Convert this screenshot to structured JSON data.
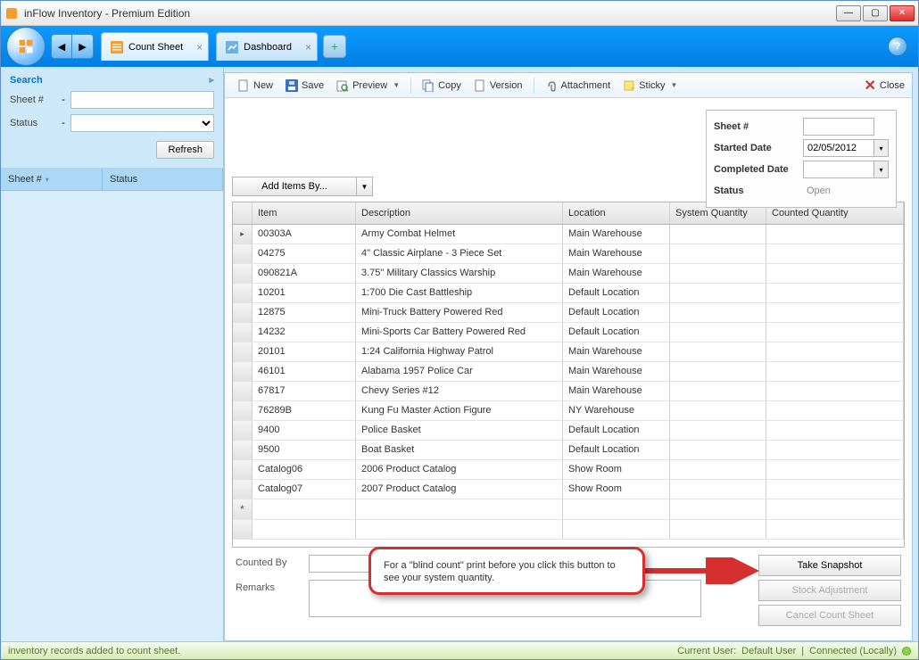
{
  "window": {
    "title": "inFlow Inventory - Premium Edition"
  },
  "tabs": [
    {
      "label": "Count Sheet",
      "active": true
    },
    {
      "label": "Dashboard",
      "active": false
    }
  ],
  "sidebar": {
    "search_title": "Search",
    "sheet_label": "Sheet #",
    "status_label": "Status",
    "refresh": "Refresh",
    "grid_head": {
      "sheet": "Sheet #",
      "status": "Status"
    }
  },
  "toolbar": {
    "new": "New",
    "save": "Save",
    "preview": "Preview",
    "copy": "Copy",
    "version": "Version",
    "attachment": "Attachment",
    "sticky": "Sticky",
    "close": "Close"
  },
  "info": {
    "sheet_label": "Sheet #",
    "sheet_value": "",
    "started_label": "Started Date",
    "started_value": "02/05/2012",
    "completed_label": "Completed Date",
    "completed_value": "",
    "status_label": "Status",
    "status_value": "Open"
  },
  "add_items_by": "Add Items By...",
  "grid": {
    "headers": {
      "item": "Item",
      "desc": "Description",
      "loc": "Location",
      "sys": "System Quantity",
      "cnt": "Counted Quantity"
    },
    "rows": [
      {
        "item": "00303A",
        "desc": "Army Combat Helmet",
        "loc": "Main Warehouse",
        "sys": "",
        "cnt": ""
      },
      {
        "item": "04275",
        "desc": "4\" Classic Airplane - 3 Piece Set",
        "loc": "Main Warehouse",
        "sys": "",
        "cnt": ""
      },
      {
        "item": "090821A",
        "desc": "3.75\" Military Classics Warship",
        "loc": "Main Warehouse",
        "sys": "",
        "cnt": ""
      },
      {
        "item": "10201",
        "desc": "1:700 Die Cast Battleship",
        "loc": "Default Location",
        "sys": "",
        "cnt": ""
      },
      {
        "item": "12875",
        "desc": "Mini-Truck Battery Powered Red",
        "loc": "Default Location",
        "sys": "",
        "cnt": ""
      },
      {
        "item": "14232",
        "desc": "Mini-Sports Car Battery Powered Red",
        "loc": "Default Location",
        "sys": "",
        "cnt": ""
      },
      {
        "item": "20101",
        "desc": "1:24 California Highway Patrol",
        "loc": "Main Warehouse",
        "sys": "",
        "cnt": ""
      },
      {
        "item": "46101",
        "desc": "Alabama 1957 Police Car",
        "loc": "Main Warehouse",
        "sys": "",
        "cnt": ""
      },
      {
        "item": "67817",
        "desc": "Chevy Series #12",
        "loc": "Main Warehouse",
        "sys": "",
        "cnt": ""
      },
      {
        "item": "76289B",
        "desc": "Kung Fu Master Action Figure",
        "loc": "NY Warehouse",
        "sys": "",
        "cnt": ""
      },
      {
        "item": "9400",
        "desc": "Police Basket",
        "loc": "Default Location",
        "sys": "",
        "cnt": ""
      },
      {
        "item": "9500",
        "desc": "Boat Basket",
        "loc": "Default Location",
        "sys": "",
        "cnt": ""
      },
      {
        "item": "Catalog06",
        "desc": "2006 Product Catalog",
        "loc": "Show Room",
        "sys": "",
        "cnt": ""
      },
      {
        "item": "Catalog07",
        "desc": "2007 Product Catalog",
        "loc": "Show Room",
        "sys": "",
        "cnt": ""
      }
    ]
  },
  "footer": {
    "counted_by_label": "Counted By",
    "counted_by_value": "",
    "remarks_label": "Remarks",
    "remarks_value": "",
    "take_snapshot": "Take Snapshot",
    "stock_adjustment": "Stock Adjustment",
    "cancel_sheet": "Cancel Count Sheet"
  },
  "callout_text": "For a \"blind count\" print before you click this button to see your system quantity.",
  "statusbar": {
    "left": "inventory records added to count sheet.",
    "user_label": "Current User:",
    "user": "Default User",
    "conn": "Connected (Locally)"
  }
}
